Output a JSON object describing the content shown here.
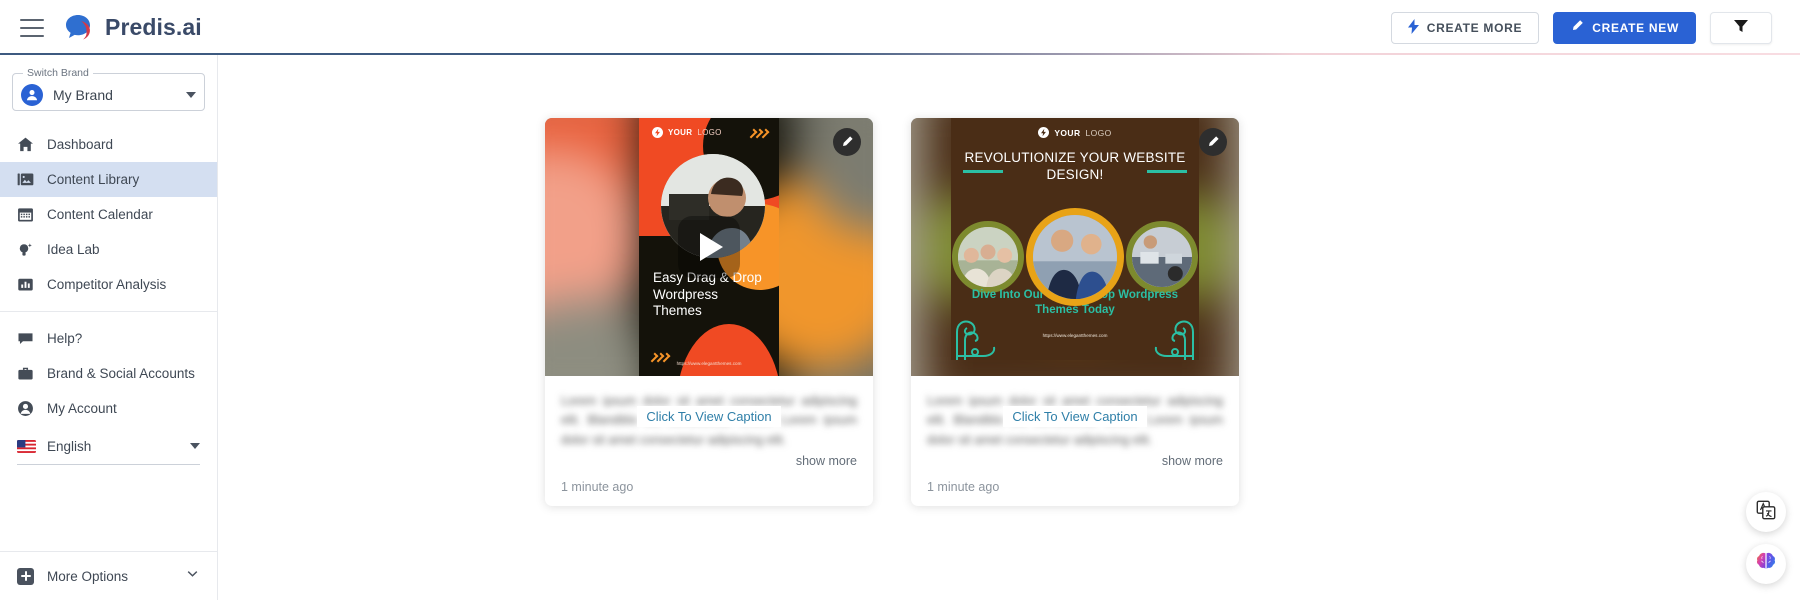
{
  "header": {
    "menu_icon": "hamburger-icon",
    "brand_name": "Predis.ai",
    "buttons": {
      "create_more": {
        "label": "CREATE MORE",
        "icon": "lightning-bolt-icon"
      },
      "create_new": {
        "label": "CREATE NEW",
        "icon": "pencil-icon"
      },
      "filter": {
        "icon": "funnel-filter-icon"
      }
    },
    "accent_color": "#2a62d4",
    "border_left_color": "#3d5a80",
    "border_right_color": "#f2d2d8"
  },
  "sidebar": {
    "brand_switch": {
      "legend": "Switch Brand",
      "value": "My Brand",
      "avatar_icon": "user-avatar-icon",
      "caret_icon": "caret-down-icon"
    },
    "items": [
      {
        "label": "Dashboard",
        "icon": "home-icon",
        "active": false
      },
      {
        "label": "Content Library",
        "icon": "image-library-icon",
        "active": true
      },
      {
        "label": "Content Calendar",
        "icon": "calendar-icon",
        "active": false
      },
      {
        "label": "Idea Lab",
        "icon": "lightbulb-icon",
        "active": false
      },
      {
        "label": "Competitor Analysis",
        "icon": "bar-chart-icon",
        "active": false
      }
    ],
    "items_secondary": [
      {
        "label": "Help?",
        "icon": "chat-bubble-icon"
      },
      {
        "label": "Brand & Social Accounts",
        "icon": "briefcase-icon"
      },
      {
        "label": "My Account",
        "icon": "user-circle-icon"
      }
    ],
    "language": {
      "label": "English",
      "flag_icon": "us-flag-icon",
      "caret_icon": "caret-down-icon"
    },
    "more_options": {
      "label": "More Options",
      "icon": "plus-square-icon",
      "chevron_icon": "chevron-down-icon"
    },
    "active_bg": "#d4dff1"
  },
  "main": {
    "cards": [
      {
        "type": "video",
        "edit_icon": "pencil-icon",
        "play_icon": "play-button-icon",
        "creative": {
          "logo_text_bold": "YOUR",
          "logo_text_light": "LOGO",
          "title": "Easy Drag & Drop Wordpress Themes",
          "url": "https://www.elegantthemes.com"
        },
        "caption_blurred": "Lorem ipsum dolor sit amet consectetur adipiscing elit. Blanditiis elit consectetur lorem. Lorem ipsum dolor sit amet consectetur adipiscing elit.",
        "caption_overlay_label": "Click To View Caption",
        "show_more_label": "show more",
        "timestamp": "1 minute ago"
      },
      {
        "type": "image",
        "edit_icon": "pencil-icon",
        "creative": {
          "logo_text_bold": "YOUR",
          "logo_text_light": "LOGO",
          "headline": "REVOLUTIONIZE YOUR WEBSITE DESIGN!",
          "subtitle": "Dive Into Our Drag & Drop Wordpress Themes Today",
          "url": "https://www.elegantthemes.com"
        },
        "caption_blurred": "Lorem ipsum dolor sit amet consectetur adipiscing elit. Blanditiis elit consectetur lorem. Lorem ipsum dolor sit amet consectetur adipiscing elit.",
        "caption_overlay_label": "Click To View Caption",
        "show_more_label": "show more",
        "timestamp": "1 minute ago"
      }
    ]
  },
  "floating": {
    "translate": {
      "icon": "translate-icon"
    },
    "ai_brain": {
      "icon": "ai-brain-icon"
    }
  }
}
